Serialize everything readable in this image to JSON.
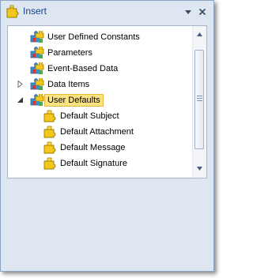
{
  "window": {
    "title": "Insert",
    "icon": "insert-puzzle-icon"
  },
  "titlebar_buttons": [
    {
      "icon": "pin-dropdown-icon"
    },
    {
      "icon": "close-icon"
    }
  ],
  "tree": {
    "items": [
      {
        "label": "User Defined Constants",
        "icon": "group-puzzle-icon",
        "level": 0,
        "expander": "none"
      },
      {
        "label": "Parameters",
        "icon": "group-puzzle-icon",
        "level": 0,
        "expander": "none"
      },
      {
        "label": "Event-Based Data",
        "icon": "group-puzzle-icon",
        "level": 0,
        "expander": "none"
      },
      {
        "label": "Data Items",
        "icon": "group-puzzle-icon",
        "level": 0,
        "expander": "collapsed"
      },
      {
        "label": "User Defaults",
        "icon": "group-puzzle-icon",
        "level": 0,
        "expander": "expanded",
        "selected": true
      },
      {
        "label": "Default Subject",
        "icon": "puzzle-piece-icon",
        "level": 1,
        "expander": "none"
      },
      {
        "label": "Default Attachment",
        "icon": "puzzle-piece-icon",
        "level": 1,
        "expander": "none"
      },
      {
        "label": "Default Message",
        "icon": "puzzle-piece-icon",
        "level": 1,
        "expander": "none"
      },
      {
        "label": "Default Signature",
        "icon": "puzzle-piece-icon",
        "level": 1,
        "expander": "none"
      }
    ]
  },
  "colors": {
    "title_text": "#15428b",
    "window_bg": "#dde6f1",
    "selection_bg": "#fce381",
    "selection_border": "#e2b840"
  }
}
